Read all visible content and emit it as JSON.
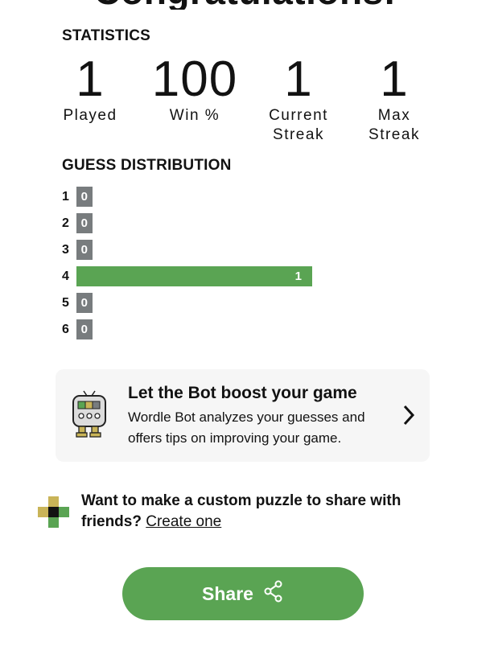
{
  "modal": {
    "title": "Congratulations!"
  },
  "statistics": {
    "heading": "STATISTICS",
    "items": [
      {
        "value": "1",
        "label_line1": "Played",
        "label_line2": ""
      },
      {
        "value": "100",
        "label_line1": "Win %",
        "label_line2": ""
      },
      {
        "value": "1",
        "label_line1": "Current",
        "label_line2": "Streak"
      },
      {
        "value": "1",
        "label_line1": "Max",
        "label_line2": "Streak"
      }
    ]
  },
  "distribution": {
    "heading": "GUESS DISTRIBUTION",
    "rows": [
      {
        "guess": "1",
        "count": "0",
        "fraction": 0,
        "highlight": false
      },
      {
        "guess": "2",
        "count": "0",
        "fraction": 0,
        "highlight": false
      },
      {
        "guess": "3",
        "count": "0",
        "fraction": 0,
        "highlight": false
      },
      {
        "guess": "4",
        "count": "1",
        "fraction": 1,
        "highlight": true
      },
      {
        "guess": "5",
        "count": "0",
        "fraction": 0,
        "highlight": false
      },
      {
        "guess": "6",
        "count": "0",
        "fraction": 0,
        "highlight": false
      }
    ]
  },
  "bot_promo": {
    "title": "Let the Bot boost your game",
    "description": "Wordle Bot analyzes your guesses and offers tips on improving your game.",
    "icon": "wordle-bot-icon",
    "arrow_icon": "chevron-right-icon"
  },
  "custom_puzzle": {
    "text": "Want to make a custom puzzle to share with friends?",
    "link_text": "Create one",
    "icon": "puzzle-grid-icon"
  },
  "share": {
    "label": "Share",
    "icon": "share-icon"
  },
  "colors": {
    "green": "#5aa453",
    "gray": "#787c7e",
    "yellow": "#c9b458",
    "card_bg": "#f6f6f6"
  }
}
